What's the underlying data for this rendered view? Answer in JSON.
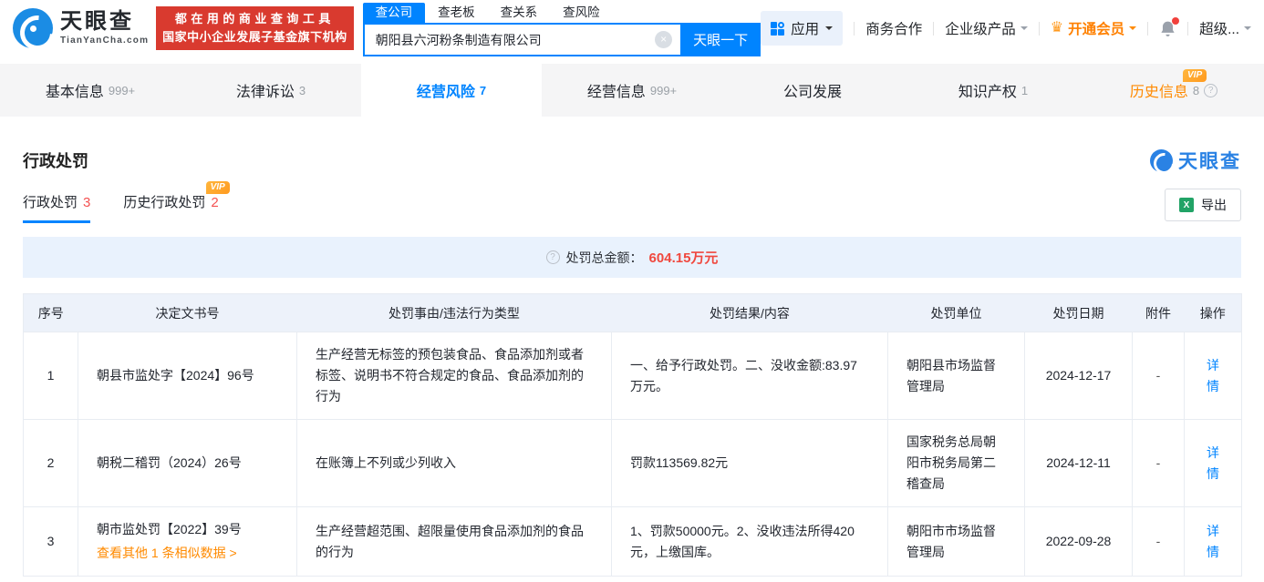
{
  "colors": {
    "brand_blue": "#0084ff",
    "promo_red": "#d93a2f",
    "vip_orange": "#ff8a00",
    "count_red": "#f45151",
    "amount_red": "#f0483e",
    "link_blue": "#0084ff",
    "table_header_bg": "#edf2fa",
    "summary_bg": "#e9f2fd"
  },
  "icons": {
    "help": "?",
    "clear": "×",
    "excel": "X",
    "crown": "♛"
  },
  "badges": {
    "vip": "VIP"
  },
  "header": {
    "logo": {
      "title": "天眼查",
      "subtitle": "TianYanCha.com"
    },
    "promo": {
      "line1": "都在用的商业查询工具",
      "line2": "国家中小企业发展子基金旗下机构"
    },
    "search": {
      "tabs": [
        {
          "label": "查公司",
          "active": true
        },
        {
          "label": "查老板",
          "active": false
        },
        {
          "label": "查关系",
          "active": false
        },
        {
          "label": "查风险",
          "active": false
        }
      ],
      "input_value": "朝阳县六河粉条制造有限公司",
      "button_label": "天眼一下"
    },
    "actions": {
      "apps_label": "应用",
      "cooperation": "商务合作",
      "enterprise": "企业级产品",
      "vip_label": "开通会员",
      "more_label": "超级..."
    }
  },
  "nav": {
    "tabs": [
      {
        "label": "基本信息",
        "count": "999+",
        "active": false,
        "vip": false,
        "help": false
      },
      {
        "label": "法律诉讼",
        "count": "3",
        "active": false,
        "vip": false,
        "help": false
      },
      {
        "label": "经营风险",
        "count": "7",
        "active": true,
        "vip": false,
        "help": false
      },
      {
        "label": "经营信息",
        "count": "999+",
        "active": false,
        "vip": false,
        "help": false
      },
      {
        "label": "公司发展",
        "count": "",
        "active": false,
        "vip": false,
        "help": false
      },
      {
        "label": "知识产权",
        "count": "1",
        "active": false,
        "vip": false,
        "help": false
      },
      {
        "label": "历史信息",
        "count": "8",
        "active": false,
        "vip": true,
        "help": true
      }
    ]
  },
  "section": {
    "title": "行政处罚",
    "watermark": "天眼查",
    "tabs": [
      {
        "label": "行政处罚",
        "count": "3",
        "active": true,
        "vip": false
      },
      {
        "label": "历史行政处罚",
        "count": "2",
        "active": false,
        "vip": true
      }
    ],
    "export_label": "导出",
    "summary_label": "处罚总金额：",
    "summary_amount": "604.15万元"
  },
  "table": {
    "columns": [
      "序号",
      "决定文书号",
      "处罚事由/违法行为类型",
      "处罚结果/内容",
      "处罚单位",
      "处罚日期",
      "附件",
      "操作"
    ],
    "rows": [
      {
        "no": "1",
        "doc_no": "朝县市监处字【2024】96号",
        "similar_link": "",
        "reason": "生产经营无标签的预包装食品、食品添加剂或者标签、说明书不符合规定的食品、食品添加剂的行为",
        "result": "一、给予行政处罚。二、没收金额:83.97万元。",
        "unit": "朝阳县市场监督管理局",
        "date": "2024-12-17",
        "attachment": "-",
        "action": "详情"
      },
      {
        "no": "2",
        "doc_no": "朝税二稽罚（2024）26号",
        "similar_link": "",
        "reason": "在账簿上不列或少列收入",
        "result": "罚款113569.82元",
        "unit": "国家税务总局朝阳市税务局第二稽查局",
        "date": "2024-12-11",
        "attachment": "-",
        "action": "详情"
      },
      {
        "no": "3",
        "doc_no": "朝市监处罚【2022】39号",
        "similar_link": "查看其他 1 条相似数据 >",
        "reason": "生产经营超范围、超限量使用食品添加剂的食品的行为",
        "result": "1、罚款50000元。2、没收违法所得420元，上缴国库。",
        "unit": "朝阳市市场监督管理局",
        "date": "2022-09-28",
        "attachment": "-",
        "action": "详情"
      }
    ]
  }
}
